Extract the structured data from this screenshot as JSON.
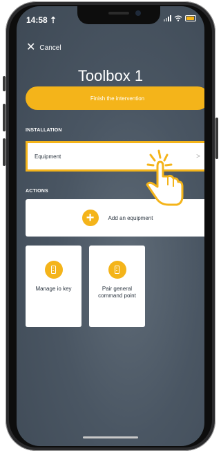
{
  "status": {
    "time": "14:58 ⇡"
  },
  "nav": {
    "cancel_label": "Cancel"
  },
  "header": {
    "title": "Toolbox 1"
  },
  "finish_button": {
    "label": "Finish the intervention"
  },
  "installation": {
    "section_label": "INSTALLATION",
    "equipment_label": "Equipment",
    "chevron": ">"
  },
  "actions": {
    "section_label": "ACTIONS",
    "add_equipment_label": "Add an equipment",
    "tiles": [
      {
        "label": "Manage io key",
        "icon": "remote-device-icon"
      },
      {
        "label": "Pair general command point",
        "icon": "remote-device-icon"
      }
    ]
  },
  "colors": {
    "accent": "#f4b41a",
    "background": "#4a5663"
  }
}
